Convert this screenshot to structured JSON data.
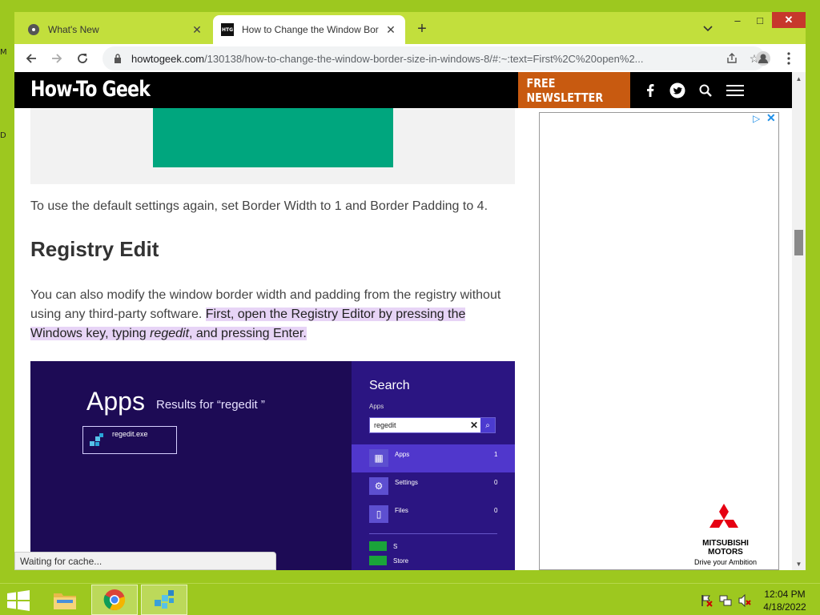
{
  "desktop": {
    "glyph_top": "M",
    "glyph_mid": "D"
  },
  "window": {
    "tabs": [
      {
        "title": "What's New",
        "icon": "chrome-icon",
        "active": false
      },
      {
        "title": "How to Change the Window Bor",
        "icon": "htg-favicon",
        "favicon_text": "HTG",
        "active": true
      }
    ],
    "new_tab": "+",
    "controls": {
      "minimize": "–",
      "maximize": "□",
      "close": "✕"
    }
  },
  "toolbar": {
    "url_host": "howtogeek.com",
    "url_path": "/130138/how-to-change-the-window-border-size-in-windows-8/#:~:text=First%2C%20open%2..."
  },
  "site": {
    "logo": "How-To Geek",
    "newsletter": "FREE NEWSLETTER"
  },
  "article": {
    "para1": "To use the default settings again, set Border Width to 1 and Border Padding to 4.",
    "heading": "Registry Edit",
    "para2_plain": "You can also modify the window border width and padding from the registry without using any third-party software. ",
    "para2_hl_a": "First, open the Registry Editor by pressing the Windows key, typing ",
    "para2_hl_em": "regedit",
    "para2_hl_b": ", and pressing Enter."
  },
  "screenshot": {
    "apps_title": "Apps",
    "results_for": "Results for “regedit ”",
    "result_item": "regedit.exe",
    "search_title": "Search",
    "apps_label": "Apps",
    "search_value": "regedit",
    "rows": [
      {
        "name": "Apps",
        "count": "1"
      },
      {
        "name": "Settings",
        "count": "0"
      },
      {
        "name": "Files",
        "count": "0"
      },
      {
        "name": "S",
        "count": ""
      },
      {
        "name": "Store",
        "count": ""
      }
    ]
  },
  "ad": {
    "brand": "MITSUBISHI MOTORS",
    "slogan": "Drive your Ambition",
    "brand_color": "#e60012"
  },
  "status": "Waiting for cache...",
  "taskbar": {
    "time": "12:04 PM",
    "date": "4/18/2022"
  },
  "colors": {
    "desktop": "#9dc81f",
    "newsletter": "#c85a10",
    "highlight": "#e7d4f6",
    "figure_green": "#00a67e"
  }
}
